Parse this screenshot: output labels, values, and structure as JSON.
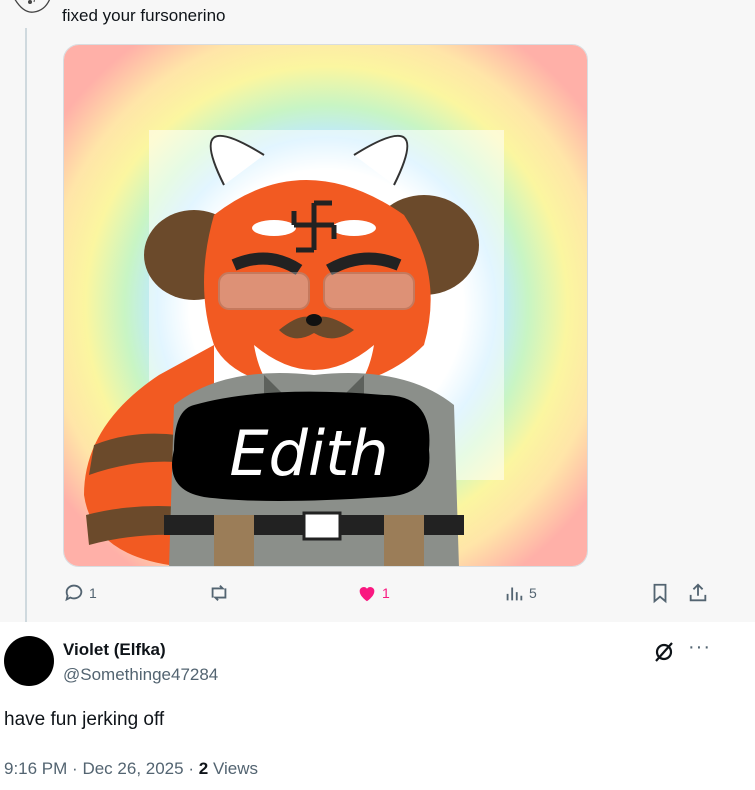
{
  "previous_tweet": {
    "text": "fixed your fursonerino",
    "image": {
      "caption_text": "Edith"
    },
    "actions": {
      "reply_count": "1",
      "retweet_count": "",
      "like_count": "1",
      "views_count": "5"
    }
  },
  "reply": {
    "display_name": "Violet (Elfka)",
    "handle": "@Somethinge47284",
    "text": "have fun jerking off",
    "time": "9:16 PM",
    "separator": "·",
    "date": "Dec 26, 2025",
    "views_count": "2",
    "views_label": "Views",
    "more_label": "···"
  },
  "colors": {
    "like_pink": "#f91880",
    "secondary_text": "#536471",
    "primary_text": "#0f1419",
    "fur_orange": "#f25a22",
    "fur_brown": "#6b4a2b"
  },
  "icons": [
    "reply-icon",
    "retweet-icon",
    "heart-icon",
    "views-icon",
    "bookmark-icon",
    "share-icon",
    "grok-icon",
    "more-icon"
  ]
}
